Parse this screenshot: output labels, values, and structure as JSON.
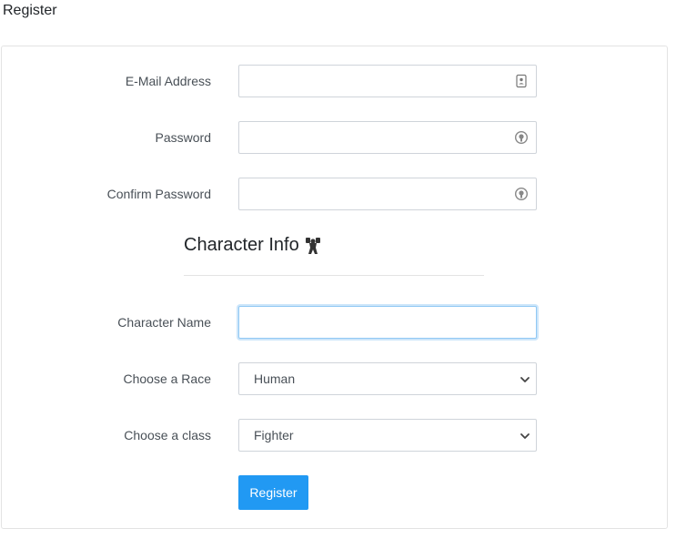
{
  "page": {
    "title": "Register"
  },
  "form": {
    "email": {
      "label": "E-Mail Address",
      "value": "",
      "icon": "contact-card-icon"
    },
    "password": {
      "label": "Password",
      "value": "",
      "icon": "password-manager-icon"
    },
    "confirm_password": {
      "label": "Confirm Password",
      "value": "",
      "icon": "password-manager-icon"
    },
    "character_section": {
      "title": "Character Info",
      "icon": "fighter-icon"
    },
    "character_name": {
      "label": "Character Name",
      "value": ""
    },
    "race": {
      "label": "Choose a Race",
      "selected": "Human"
    },
    "class": {
      "label": "Choose a class",
      "selected": "Fighter"
    },
    "submit_label": "Register"
  },
  "colors": {
    "accent": "#2199f3",
    "focus": "#90c8f4"
  }
}
